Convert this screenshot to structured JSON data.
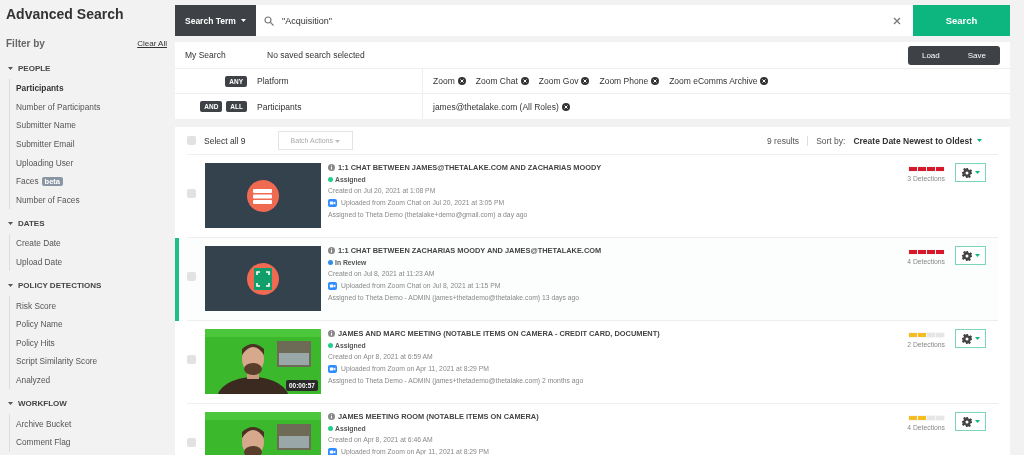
{
  "sidebar": {
    "title": "Advanced Search",
    "filter_label": "Filter by",
    "clear_all": "Clear All",
    "sections": [
      {
        "label": "PEOPLE",
        "expanded": true,
        "items": [
          {
            "label": "Participants",
            "selected": true
          },
          {
            "label": "Number of Participants",
            "selected": false
          },
          {
            "label": "Submitter Name",
            "selected": false
          },
          {
            "label": "Submitter Email",
            "selected": false
          },
          {
            "label": "Uploading User",
            "selected": false
          },
          {
            "label": "Faces",
            "badge": "beta",
            "selected": false
          },
          {
            "label": "Number of Faces",
            "selected": false
          }
        ]
      },
      {
        "label": "DATES",
        "expanded": true,
        "items": [
          {
            "label": "Create Date",
            "selected": false
          },
          {
            "label": "Upload Date",
            "selected": false
          }
        ]
      },
      {
        "label": "POLICY DETECTIONS",
        "expanded": true,
        "items": [
          {
            "label": "Risk Score",
            "selected": false
          },
          {
            "label": "Policy Name",
            "selected": false
          },
          {
            "label": "Policy Hits",
            "selected": false
          },
          {
            "label": "Script Similarity Score",
            "selected": false
          },
          {
            "label": "Analyzed",
            "selected": false
          }
        ]
      },
      {
        "label": "WORKFLOW",
        "expanded": true,
        "items": [
          {
            "label": "Archive Bucket",
            "selected": false
          },
          {
            "label": "Comment Flag",
            "selected": false
          }
        ]
      }
    ]
  },
  "search": {
    "mode": "Search Term",
    "value": "\"Acquisition\"",
    "button": "Search"
  },
  "my_search": {
    "label": "My Search",
    "value": "No saved search selected",
    "buttons": [
      "Load",
      "Save"
    ]
  },
  "filters": [
    {
      "operators": [
        "ANY"
      ],
      "field": "Platform",
      "values": [
        "Zoom",
        "Zoom Chat",
        "Zoom Gov",
        "Zoom Phone",
        "Zoom eComms Archive"
      ]
    },
    {
      "operators": [
        "AND",
        "ALL"
      ],
      "field": "Participants",
      "values": [
        "james@thetalake.com (All Roles)"
      ]
    }
  ],
  "results": {
    "select_all": "Select all 9",
    "select_all_checked": false,
    "batch_actions": "Batch Actions",
    "count": "9 results",
    "sort_label": "Sort by:",
    "sort_value": "Create Date Newest to Oldest",
    "rows": [
      {
        "selected": false,
        "checked": false,
        "thumbnail": {
          "kind": "chat"
        },
        "title": "1:1 CHAT BETWEEN JAMES@THETALAKE.COM AND ZACHARIAS MOODY",
        "status": {
          "label": "Assigned",
          "color": "#1fcf8a"
        },
        "created": "Created on Jul 20, 2021 at 1:08 PM",
        "uploaded": "Uploaded from Zoom Chat on Jul 20, 2021 at 3:05 PM",
        "assigned": "Assigned to Theta Demo (thetalake+demo@gmail.com) a day ago",
        "risk": {
          "level": 1,
          "color": "#d7182a"
        },
        "detections": "3 Detections"
      },
      {
        "selected": true,
        "checked": false,
        "thumbnail": {
          "kind": "screen"
        },
        "title": "1:1 CHAT BETWEEN ZACHARIAS MOODY AND JAMES@THETALAKE.COM",
        "status": {
          "label": "In Review",
          "color": "#2a8fe8"
        },
        "created": "Created on Jul 8, 2021 at 11:23 AM",
        "uploaded": "Uploaded from Zoom Chat on Jul 8, 2021 at 1:15 PM",
        "assigned": "Assigned to Theta Demo - ADMIN (james+thetademo@thetalake.com) 13 days ago",
        "risk": {
          "level": 1,
          "color": "#d7182a"
        },
        "detections": "4 Detections"
      },
      {
        "selected": false,
        "checked": false,
        "thumbnail": {
          "kind": "picture",
          "duration": "00:00:57"
        },
        "title": "JAMES AND MARC MEETING (NOTABLE ITEMS ON CAMERA - CREDIT CARD, DOCUMENT)",
        "status": {
          "label": "Assigned",
          "color": "#1fcf8a"
        },
        "created": "Created on Apr 8, 2021 at 6:59 AM",
        "uploaded": "Uploaded from Zoom on Apr 11, 2021 at 8:29 PM",
        "assigned": "Assigned to Theta Demo - ADMIN (james+thetademo@thetalake.com) 2 months ago",
        "risk": {
          "level": 0.5,
          "color": "#f5bd1f"
        },
        "detections": "2 Detections"
      },
      {
        "selected": false,
        "checked": false,
        "title": "JAMES MEETING ROOM (NOTABLE ITEMS ON CAMERA)",
        "status": {
          "label": "Assigned",
          "color": "#1fcf8a"
        },
        "created": "Created on Apr 8, 2021 at 6:46 AM",
        "uploaded": "Uploaded from Zoom on Apr 11, 2021 at 8:29 PM",
        "risk": {
          "level": 0.5,
          "color": "#f5bd1f"
        },
        "detections": "4 Detections"
      }
    ]
  }
}
